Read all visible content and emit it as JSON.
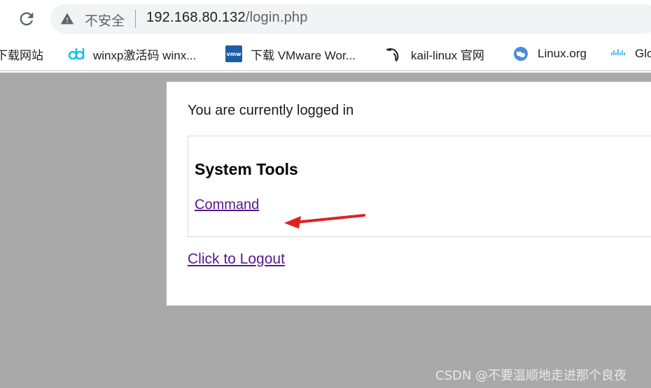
{
  "browser": {
    "security_label": "不安全",
    "url_host": "192.168.80.132",
    "url_path": "/login.php"
  },
  "bookmarks": [
    {
      "label": "下载网站",
      "icon": "folder-icon"
    },
    {
      "label": "winxp激活码 winx...",
      "icon": "dd-logo-icon"
    },
    {
      "label": "下载 VMware Wor...",
      "icon": "vmw-logo-icon"
    },
    {
      "label": "kail-linux 官网",
      "icon": "kali-dragon-icon"
    },
    {
      "label": "Linux.org",
      "icon": "globe-icon"
    },
    {
      "label": "Glo",
      "icon": "cisco-logo-icon"
    }
  ],
  "page": {
    "status_text": "You are currently logged in",
    "tools_heading": "System Tools",
    "command_link": "Command",
    "logout_link": "Click to Logout"
  },
  "annotation": {
    "arrow_color": "#e02020"
  },
  "watermark": "CSDN @不要温顺地走进那个良夜"
}
